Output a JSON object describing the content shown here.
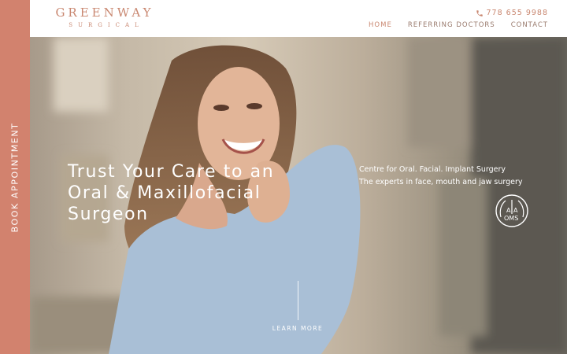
{
  "sidebar": {
    "book_label": "BOOK APPOINTMENT"
  },
  "header": {
    "logo_main": "GREENWAY",
    "logo_sub": "SURGICAL",
    "phone": "778 655 9988",
    "nav": [
      {
        "label": "HOME",
        "active": true
      },
      {
        "label": "REFERRING DOCTORS"
      },
      {
        "label": "CONTACT"
      }
    ]
  },
  "hero": {
    "title": "Trust Your Care to an Oral & Maxillofacial Surgeon",
    "side_line1": "Centre for Oral. Facial. Implant Surgery",
    "side_line2": "The experts in face, mouth and jaw surgery",
    "badge_text_a": "A",
    "badge_text_a2": "A",
    "badge_text_oms": "OMS",
    "learn_more": "LEARN MORE"
  },
  "colors": {
    "accent": "#d2826e",
    "logo": "#c98770"
  },
  "icons": {
    "phone": "phone-icon",
    "badge": "aaoms-badge-icon"
  }
}
